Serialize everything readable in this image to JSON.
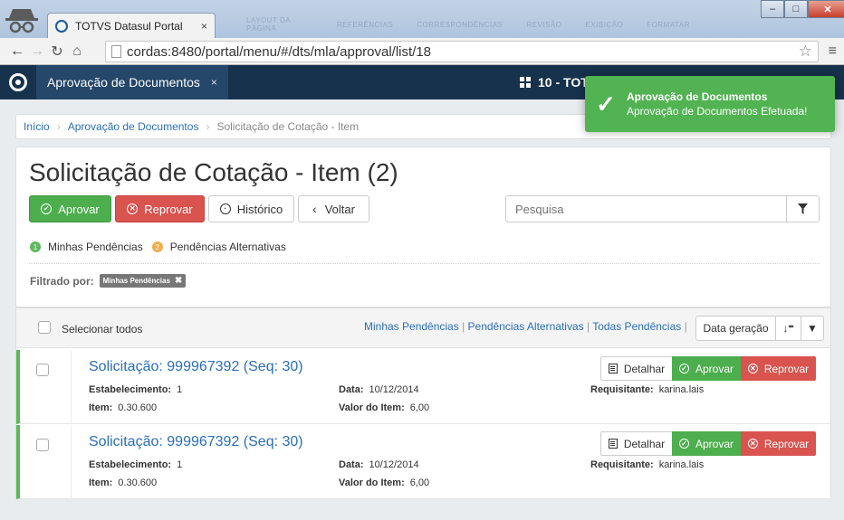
{
  "browser": {
    "tab_title": "TOTVS Datasul Portal",
    "tab_close": "×",
    "url": "cordas:8480/portal/menu/#/dts/mla/approval/list/18",
    "bg_tabs": [
      "LAYOUT DA PÁGINA",
      "REFERÊNCIAS",
      "CORRESPONDÊNCIAS",
      "REVISÃO",
      "EXIBIÇÃO",
      "FORMATAR"
    ]
  },
  "app": {
    "tab_label": "Aprovação de Documentos",
    "tab_close": "×",
    "company": "10 - TOT"
  },
  "toast": {
    "title": "Aprovação de Documentos",
    "message": "Aprovação de Documentos Efetuada!",
    "color": "#51b351"
  },
  "breadcrumb": {
    "home": "Início",
    "section": "Aprovação de Documentos",
    "current": "Solicitação de Cotação - Item"
  },
  "page": {
    "title": "Solicitação de Cotação - Item (2)",
    "buttons": {
      "approve": "Aprovar",
      "reject": "Reprovar",
      "history": "Histórico",
      "back": "Voltar"
    },
    "search_placeholder": "Pesquisa",
    "legend": [
      {
        "num": "1",
        "label": "Minhas Pendências",
        "color": "#5cb85c"
      },
      {
        "num": "2",
        "label": "Pendências Alternativas",
        "color": "#f0ad4e"
      }
    ],
    "filtered_label": "Filtrado por:",
    "filter_chip": "Minhas Pendências"
  },
  "list": {
    "select_all": "Selecionar todos",
    "filter_links": [
      "Minhas Pendências",
      "Pendências Alternativas",
      "Todas Pendências"
    ],
    "sort_field": "Data geração",
    "items": [
      {
        "title": "Solicitação: 999967392 (Seq: 30)",
        "estab_label": "Estabelecimento:",
        "estab": "1",
        "item_label": "Item:",
        "item": "0.30.600",
        "date_label": "Data:",
        "date": "10/12/2014",
        "value_label": "Valor do Item:",
        "value": "6,00",
        "req_label": "Requisitante:",
        "req": "karina.lais",
        "detail": "Detalhar",
        "approve": "Aprovar",
        "reject": "Reprovar"
      },
      {
        "title": "Solicitação: 999967392 (Seq: 30)",
        "estab_label": "Estabelecimento:",
        "estab": "1",
        "item_label": "Item:",
        "item": "0.30.600",
        "date_label": "Data:",
        "date": "10/12/2014",
        "value_label": "Valor do Item:",
        "value": "6,00",
        "req_label": "Requisitante:",
        "req": "karina.lais",
        "detail": "Detalhar",
        "approve": "Aprovar",
        "reject": "Reprovar"
      }
    ]
  },
  "colors": {
    "header": "#17324d",
    "approve": "#4cae4c",
    "reject": "#d9534f",
    "link": "#2a6ebb"
  }
}
